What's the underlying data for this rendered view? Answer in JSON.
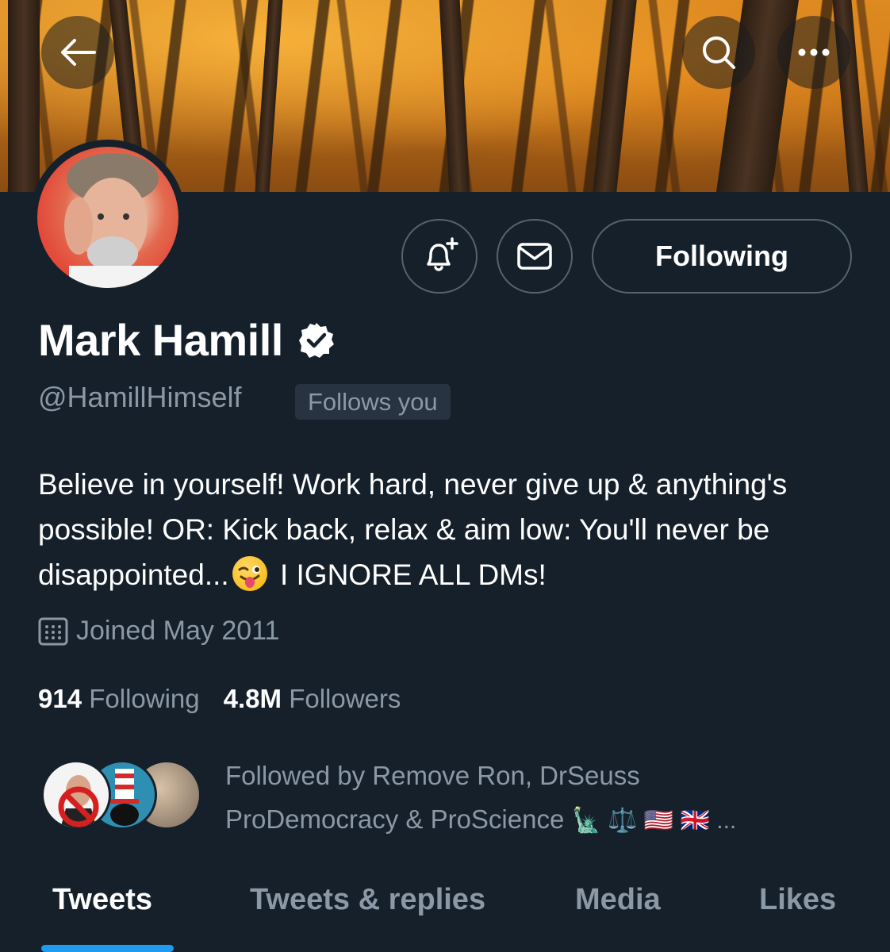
{
  "header": {
    "back_icon": "arrow-left-icon",
    "search_icon": "search-icon",
    "more_icon": "more-horizontal-icon"
  },
  "profile": {
    "name": "Mark Hamill",
    "verified_icon": "verified-badge-icon",
    "handle": "@HamillHimself",
    "follows_you": "Follows you",
    "bio_part1": "Believe in yourself! Work hard, never give up & anything's possible! OR: Kick back, relax & aim low: You'll never be disappointed...",
    "bio_emoji": "winking-face-with-tongue-emoji",
    "bio_part2": " I IGNORE ALL DMs!",
    "joined": "Joined May 2011",
    "following_count": "914",
    "following_label": "Following",
    "followers_count": "4.8M",
    "followers_label": "Followers"
  },
  "actions": {
    "notify_icon": "bell-plus-icon",
    "message_icon": "mail-icon",
    "following_button": "Following"
  },
  "followed_by": {
    "line1": "Followed by Remove Ron, DrSeuss",
    "line2": "ProDemocracy & ProScience",
    "line2_suffix": "🗽 ⚖️ 🇺🇸 🇬🇧 ..."
  },
  "tabs": [
    {
      "label": "Tweets",
      "active": true
    },
    {
      "label": "Tweets & replies",
      "active": false
    },
    {
      "label": "Media",
      "active": false
    },
    {
      "label": "Likes",
      "active": false
    }
  ],
  "colors": {
    "background": "#15202b",
    "accent": "#1d9bf0",
    "secondary_text": "#8b98a5",
    "border": "#536471"
  }
}
